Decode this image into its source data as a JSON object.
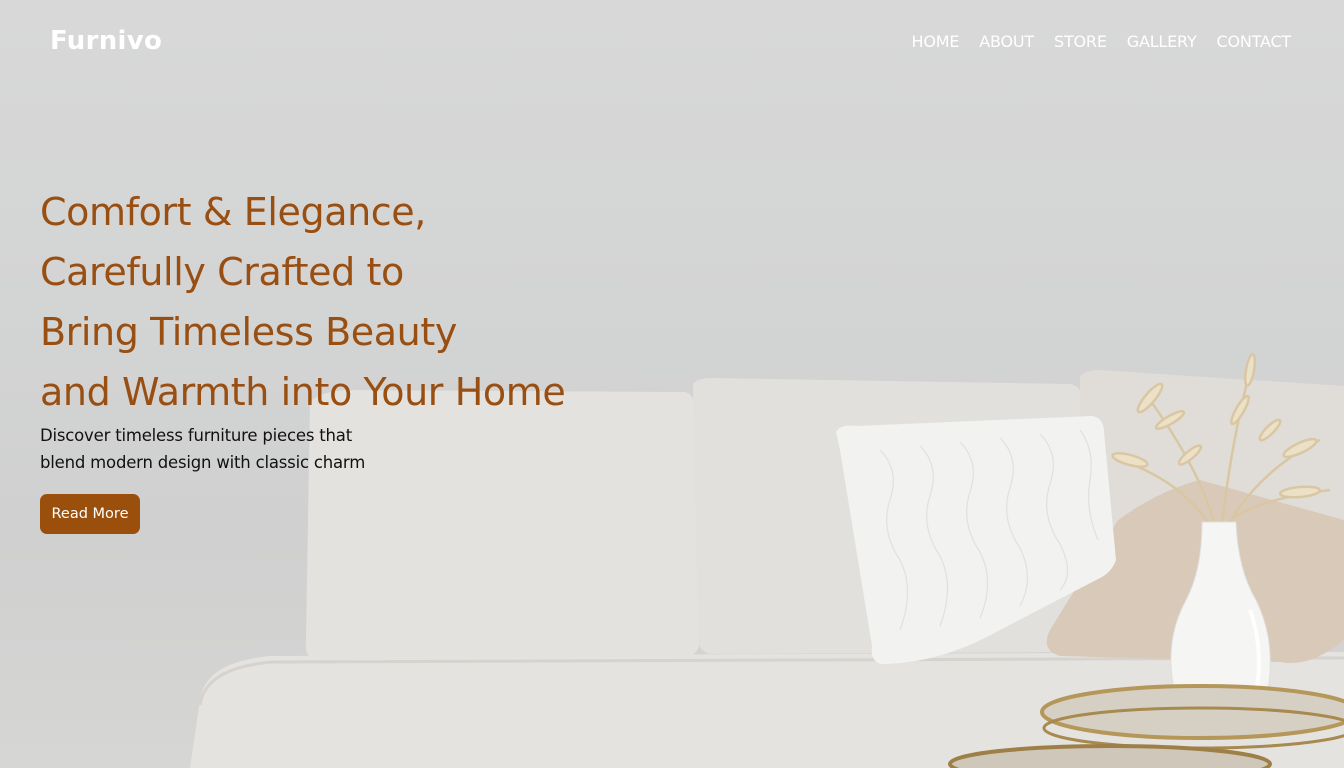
{
  "brand": {
    "name": "Furnivo"
  },
  "nav": {
    "items": [
      {
        "label": "HOME"
      },
      {
        "label": "ABOUT"
      },
      {
        "label": "STORE"
      },
      {
        "label": "GALLERY"
      },
      {
        "label": "CONTACT"
      }
    ]
  },
  "hero": {
    "headline_lines": [
      "Comfort & Elegance,",
      "Carefully Crafted to",
      "Bring Timeless Beauty",
      "and Warmth into Your Home"
    ],
    "subtext_lines": [
      "Discover timeless furniture pieces that",
      "blend modern design with classic charm"
    ],
    "cta_label": "Read More"
  },
  "colors": {
    "accent": "#9a4f0c",
    "headline": "#9a4f12",
    "nav_text": "#ffffff",
    "background": "#d4d4d4"
  }
}
